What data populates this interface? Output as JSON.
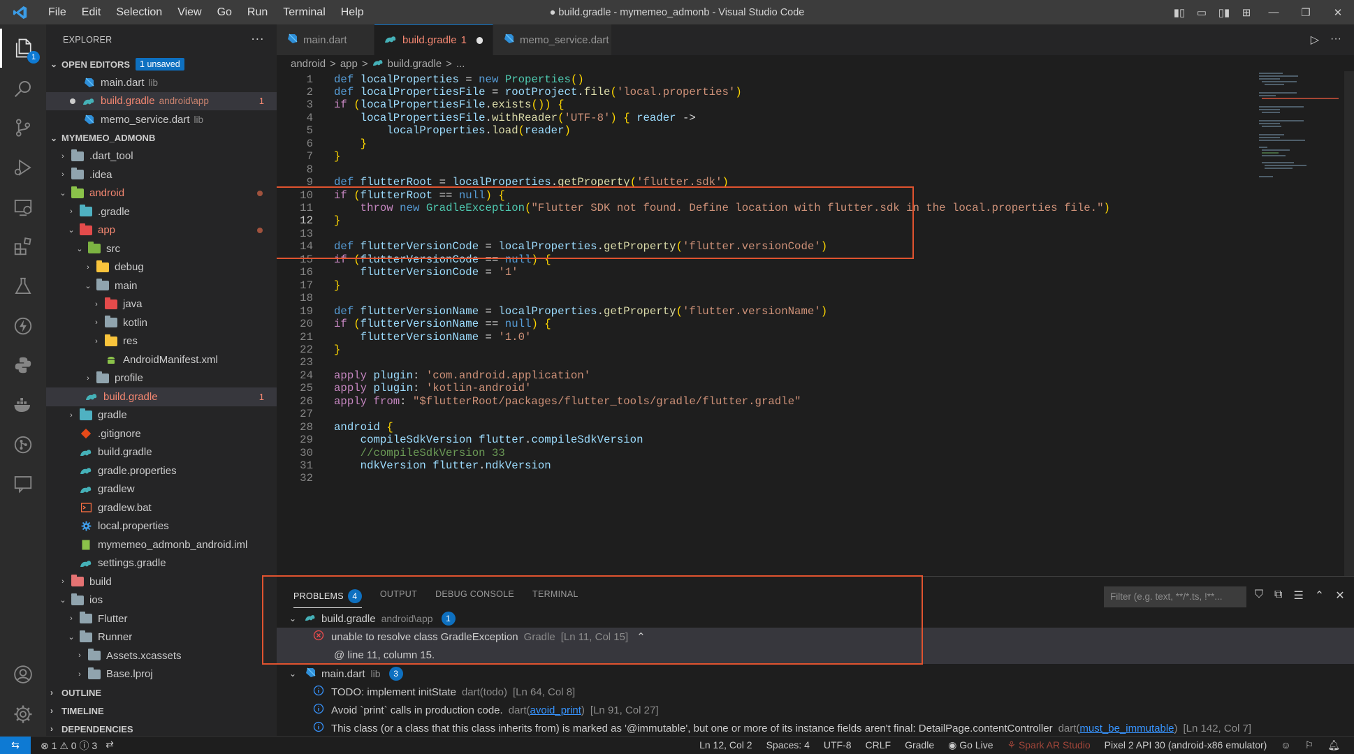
{
  "titlebar": {
    "menu": [
      "File",
      "Edit",
      "Selection",
      "View",
      "Go",
      "Run",
      "Terminal",
      "Help"
    ],
    "title": "● build.gradle - mymemeo_admonb - Visual Studio Code"
  },
  "activity": {
    "explorer_badge": "1"
  },
  "sidebar": {
    "title": "EXPLORER",
    "open_editors": {
      "label": "OPEN EDITORS",
      "badge": "1 unsaved",
      "items": [
        {
          "name": "main.dart",
          "desc": "lib"
        },
        {
          "name": "build.gradle",
          "desc": "android\\app",
          "count": "1"
        },
        {
          "name": "memo_service.dart",
          "desc": "lib"
        }
      ]
    },
    "project": {
      "label": "MYMEMEO_ADMONB",
      "tree": [
        {
          "name": ".dart_tool"
        },
        {
          "name": ".idea"
        },
        {
          "name": "android"
        },
        {
          "name": ".gradle"
        },
        {
          "name": "app"
        },
        {
          "name": "src"
        },
        {
          "name": "debug"
        },
        {
          "name": "main"
        },
        {
          "name": "java"
        },
        {
          "name": "kotlin"
        },
        {
          "name": "res"
        },
        {
          "name": "AndroidManifest.xml"
        },
        {
          "name": "profile"
        },
        {
          "name": "build.gradle",
          "count": "1"
        },
        {
          "name": "gradle"
        },
        {
          "name": ".gitignore"
        },
        {
          "name": "build.gradle"
        },
        {
          "name": "gradle.properties"
        },
        {
          "name": "gradlew"
        },
        {
          "name": "gradlew.bat"
        },
        {
          "name": "local.properties"
        },
        {
          "name": "mymemeo_admonb_android.iml"
        },
        {
          "name": "settings.gradle"
        },
        {
          "name": "build"
        },
        {
          "name": "ios"
        },
        {
          "name": "Flutter"
        },
        {
          "name": "Runner"
        },
        {
          "name": "Assets.xcassets"
        },
        {
          "name": "Base.lproj"
        }
      ]
    },
    "outline": "OUTLINE",
    "timeline": "TIMELINE",
    "dependencies": "DEPENDENCIES"
  },
  "tabs": [
    {
      "label": "main.dart"
    },
    {
      "label": "build.gradle",
      "count": "1"
    },
    {
      "label": "memo_service.dart"
    }
  ],
  "breadcrumb": [
    "android",
    ">",
    "app",
    ">",
    "build.gradle",
    ">",
    "..."
  ],
  "editor": {
    "line_numbers": [
      "1",
      "2",
      "3",
      "4",
      "5",
      "6",
      "7",
      "8",
      "9",
      "10",
      "11",
      "12",
      "13",
      "14",
      "15",
      "16",
      "17",
      "18",
      "19",
      "20",
      "21",
      "22",
      "23",
      "24",
      "25",
      "26",
      "27",
      "28",
      "29",
      "30",
      "31",
      "32"
    ],
    "current_line": "12",
    "lines": [
      "def localProperties = new Properties()",
      "def localPropertiesFile = rootProject.file('local.properties')",
      "if (localPropertiesFile.exists()) {",
      "    localPropertiesFile.withReader('UTF-8') { reader ->",
      "        localProperties.load(reader)",
      "    }",
      "}",
      "",
      "def flutterRoot = localProperties.getProperty('flutter.sdk')",
      "if (flutterRoot == null) {",
      "    throw new GradleException(\"Flutter SDK not found. Define location with flutter.sdk in the local.properties file.\")",
      "}",
      "",
      "def flutterVersionCode = localProperties.getProperty('flutter.versionCode')",
      "if (flutterVersionCode == null) {",
      "    flutterVersionCode = '1'",
      "}",
      "",
      "def flutterVersionName = localProperties.getProperty('flutter.versionName')",
      "if (flutterVersionName == null) {",
      "    flutterVersionName = '1.0'",
      "}",
      "",
      "apply plugin: 'com.android.application'",
      "apply plugin: 'kotlin-android'",
      "apply from: \"$flutterRoot/packages/flutter_tools/gradle/flutter.gradle\"",
      "",
      "android {",
      "    compileSdkVersion flutter.compileSdkVersion",
      "    //compileSdkVersion 33",
      "    ndkVersion flutter.ndkVersion",
      ""
    ]
  },
  "panel": {
    "tabs": [
      "PROBLEMS",
      "OUTPUT",
      "DEBUG CONSOLE",
      "TERMINAL"
    ],
    "problems_count": "4",
    "filter_placeholder": "Filter (e.g. text, **/*.ts, !**...",
    "groups": [
      {
        "file": "build.gradle",
        "path": "android\\app",
        "count": "1",
        "items": [
          {
            "message": "unable to resolve class GradleException",
            "source": "Gradle",
            "location": "[Ln 11, Col 15]"
          },
          {
            "message": "@ line 11, column 15."
          }
        ]
      },
      {
        "file": "main.dart",
        "path": "lib",
        "count": "3",
        "items": [
          {
            "message": "TODO: implement initState",
            "source": "dart(todo)",
            "location": "[Ln 64, Col 8]"
          },
          {
            "message": "Avoid `print` calls in production code.",
            "source": "dart(",
            "link": "avoid_print",
            "source_end": ")",
            "location": "[Ln 91, Col 27]"
          },
          {
            "message": "This class (or a class that this class inherits from) is marked as '@immutable', but one or more of its instance fields aren't final: DetailPage.contentController",
            "source": "dart(",
            "link": "must_be_immutable",
            "source_end": ")",
            "location": "[Ln 142, Col 7]"
          }
        ]
      }
    ]
  },
  "statusbar": {
    "errors": "1",
    "warnings": "0",
    "infos": "3",
    "cursor": "Ln 12, Col 2",
    "spaces": "Spaces: 4",
    "encoding": "UTF-8",
    "eol": "CRLF",
    "language": "Gradle",
    "golive": "Go Live",
    "spark": "Spark AR Studio",
    "device": "Pixel 2 API 30 (android-x86 emulator)"
  },
  "colors": {
    "error": "#f48771",
    "accent": "#0e70c0",
    "highlight_box": "#e0532f"
  }
}
